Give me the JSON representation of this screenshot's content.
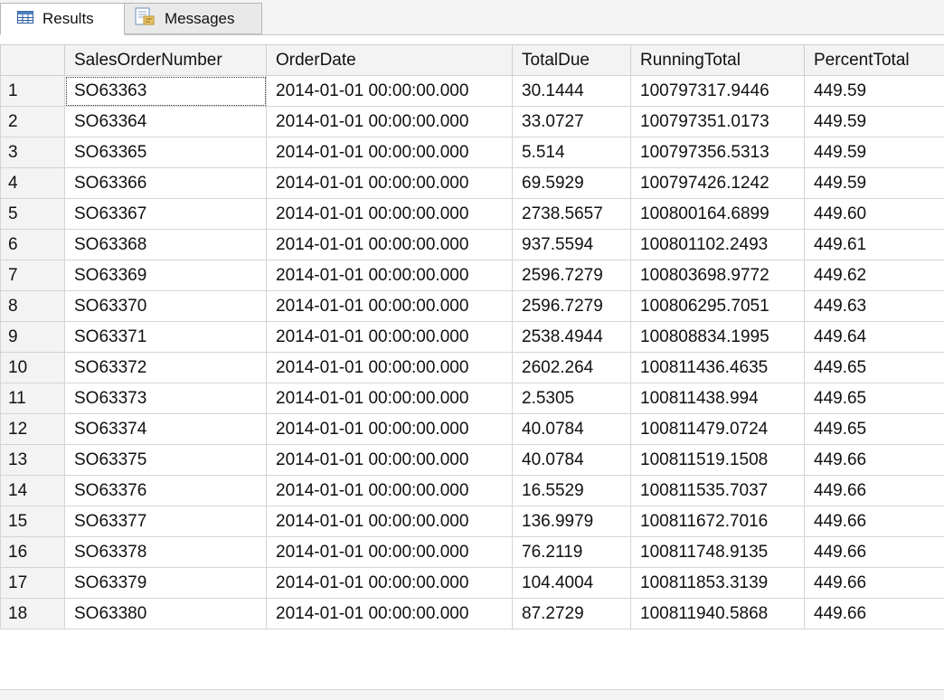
{
  "tabs": [
    {
      "label": "Results",
      "icon": "grid-icon"
    },
    {
      "label": "Messages",
      "icon": "messages-icon"
    }
  ],
  "grid": {
    "columns": [
      "",
      "SalesOrderNumber",
      "OrderDate",
      "TotalDue",
      "RunningTotal",
      "PercentTotal"
    ],
    "rows": [
      [
        "1",
        "SO63363",
        "2014-01-01 00:00:00.000",
        "30.1444",
        "100797317.9446",
        "449.59"
      ],
      [
        "2",
        "SO63364",
        "2014-01-01 00:00:00.000",
        "33.0727",
        "100797351.0173",
        "449.59"
      ],
      [
        "3",
        "SO63365",
        "2014-01-01 00:00:00.000",
        "5.514",
        "100797356.5313",
        "449.59"
      ],
      [
        "4",
        "SO63366",
        "2014-01-01 00:00:00.000",
        "69.5929",
        "100797426.1242",
        "449.59"
      ],
      [
        "5",
        "SO63367",
        "2014-01-01 00:00:00.000",
        "2738.5657",
        "100800164.6899",
        "449.60"
      ],
      [
        "6",
        "SO63368",
        "2014-01-01 00:00:00.000",
        "937.5594",
        "100801102.2493",
        "449.61"
      ],
      [
        "7",
        "SO63369",
        "2014-01-01 00:00:00.000",
        "2596.7279",
        "100803698.9772",
        "449.62"
      ],
      [
        "8",
        "SO63370",
        "2014-01-01 00:00:00.000",
        "2596.7279",
        "100806295.7051",
        "449.63"
      ],
      [
        "9",
        "SO63371",
        "2014-01-01 00:00:00.000",
        "2538.4944",
        "100808834.1995",
        "449.64"
      ],
      [
        "10",
        "SO63372",
        "2014-01-01 00:00:00.000",
        "2602.264",
        "100811436.4635",
        "449.65"
      ],
      [
        "11",
        "SO63373",
        "2014-01-01 00:00:00.000",
        "2.5305",
        "100811438.994",
        "449.65"
      ],
      [
        "12",
        "SO63374",
        "2014-01-01 00:00:00.000",
        "40.0784",
        "100811479.0724",
        "449.65"
      ],
      [
        "13",
        "SO63375",
        "2014-01-01 00:00:00.000",
        "40.0784",
        "100811519.1508",
        "449.66"
      ],
      [
        "14",
        "SO63376",
        "2014-01-01 00:00:00.000",
        "16.5529",
        "100811535.7037",
        "449.66"
      ],
      [
        "15",
        "SO63377",
        "2014-01-01 00:00:00.000",
        "136.9979",
        "100811672.7016",
        "449.66"
      ],
      [
        "16",
        "SO63378",
        "2014-01-01 00:00:00.000",
        "76.2119",
        "100811748.9135",
        "449.66"
      ],
      [
        "17",
        "SO63379",
        "2014-01-01 00:00:00.000",
        "104.4004",
        "100811853.3139",
        "449.66"
      ],
      [
        "18",
        "SO63380",
        "2014-01-01 00:00:00.000",
        "87.2729",
        "100811940.5868",
        "449.66"
      ]
    ]
  }
}
